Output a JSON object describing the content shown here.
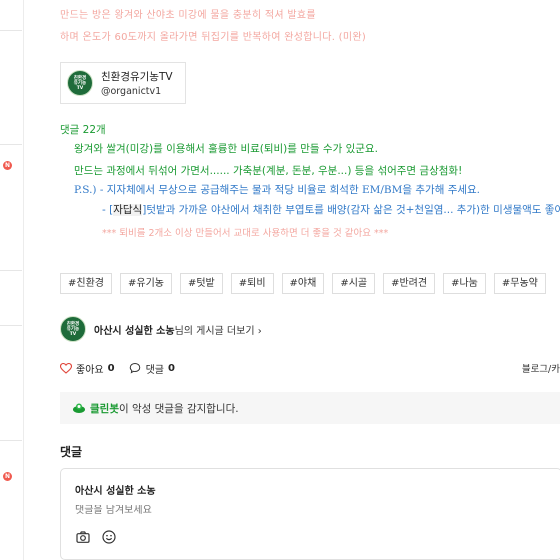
{
  "handwritten": {
    "line1": "만드는 방은 왕겨와 산야초 미강에 물을 충분히 적셔 발효를",
    "line2": "하며 온도가 60도까지 올라가면 뒤집기를 반복하여 완성합니다. (미완)"
  },
  "channel": {
    "logo_lines": [
      "친환경",
      "유기농",
      "TV"
    ],
    "name": "친환경유기농TV",
    "handle": "@organictv1"
  },
  "post": {
    "comment_count": "댓글 22개",
    "line1": "왕겨와 쌀겨(미강)를 이용해서 훌륭한 비료(퇴비)를 만들 수가 있군요.",
    "line2": "만드는 과정에서 뒤섞어 가면서...... 가축분(계분, 돈분, 우분...) 등을 섞어주면 금상첨화!",
    "line3": "P.S.) - 지자체에서 무상으로 공급해주는 물과 적당 비율로 희석한 EM/BM을 추가해 주세요.",
    "line4_prefix": "- [",
    "line4_bracket": "자답식",
    "line4_rest": "]텃밭과 가까운 야산에서 채취한 부엽토를 배양(감자 삶은 것+천일염... 추가)한 미생물액도 좋아요",
    "line5": "*** 퇴비를 2개소 이상 만들어서 교대로 사용하면 더 좋을 것 같아요 ***"
  },
  "tags": [
    "#친환경",
    "#유기농",
    "#텃밭",
    "#퇴비",
    "#야채",
    "#시골",
    "#반려견",
    "#나눔",
    "#무농약"
  ],
  "author": {
    "name": "아산시 성실한 소농",
    "suffix": "님의 게시글 더보기",
    "chevron": "›"
  },
  "actions": {
    "like_label": "좋아요",
    "like_count": "0",
    "comment_label": "댓글",
    "comment_count": "0",
    "share_label": "블로그/카"
  },
  "cleanbot": {
    "name": "클린봇",
    "message": "이 악성 댓글을 감지합니다."
  },
  "comments": {
    "title": "댓글",
    "author": "아산시 성실한 소농",
    "placeholder": "댓글을 남겨보세요"
  },
  "colors": {
    "green": "#1a9a32",
    "blue": "#3179c8",
    "note_pink": "#f3a7a0",
    "badge_red": "#f05a4f"
  }
}
